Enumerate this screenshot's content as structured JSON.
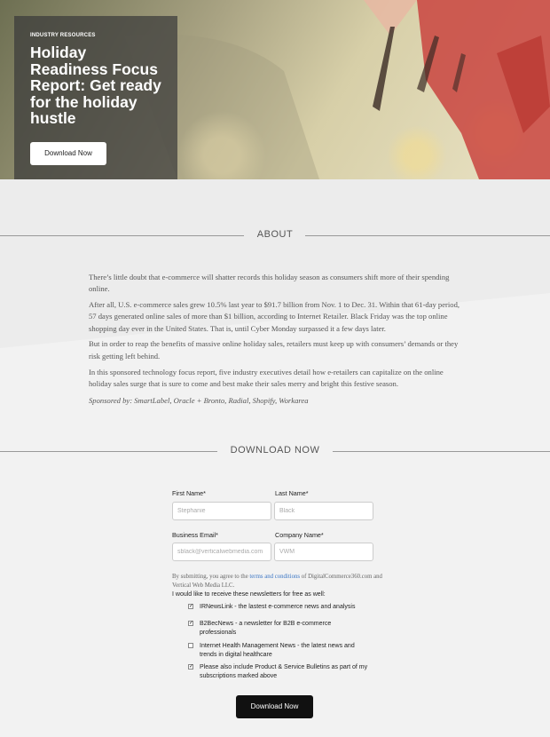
{
  "hero": {
    "eyebrow": "INDUSTRY RESOURCES",
    "title": "Holiday Readiness Focus Report: Get ready for the holiday hustle",
    "button": "Download Now"
  },
  "about": {
    "heading": "ABOUT",
    "paragraphs": [
      "There’s little doubt that e-commerce will shatter records this holiday season as consumers shift more of their spending online.",
      "After all, U.S. e-commerce sales grew 10.5% last year to $91.7 billion from Nov. 1 to Dec. 31. Within that 61-day period, 57 days generated online sales of more than $1 billion, according to Internet Retailer. Black Friday was the top online shopping day ever in the United States. That is, until Cyber Monday surpassed it a few days later.",
      "But in order to reap the benefits of massive online holiday sales, retailers must keep up with consumers’ demands or they risk getting left behind.",
      "In this sponsored technology focus report, five industry executives detail how e-retailers can capitalize on the online holiday sales surge that is sure to come and best make their sales merry and bright this festive season."
    ],
    "sponsor": "Sponsored by: SmartLabel, Oracle + Bronto, Radial, Shopify, Workarea"
  },
  "download": {
    "heading": "DOWNLOAD NOW",
    "fields": {
      "first_name": {
        "label": "First Name*",
        "placeholder": "Stephanie"
      },
      "last_name": {
        "label": "Last Name*",
        "placeholder": "Black"
      },
      "email": {
        "label": "Business Email*",
        "placeholder": "sblack@verticalwebmedia.com"
      },
      "company": {
        "label": "Company Name*",
        "placeholder": "VWM"
      }
    },
    "consent_pre": "By submitting, you agree to the ",
    "consent_link": "terms and conditions",
    "consent_post": " of DigitalCommerce360.com and Vertical Web Media LLC.",
    "newsletter_intro": "I would like to receive these newsletters for free as well:",
    "newsletters": [
      {
        "label": "IRNewsLink - the lastest e-commerce news and analysis",
        "checked": true
      },
      {
        "label": "B2BecNews - a newsletter for B2B e-commerce professionals",
        "checked": true
      },
      {
        "label": "Internet Health Management News - the latest news and trends in digital healthcare",
        "checked": false
      },
      {
        "label": "Please also include Product & Service Bulletins as part of my subscriptions marked above",
        "checked": true
      }
    ],
    "submit": "Download Now",
    "checkmark": "✓"
  }
}
